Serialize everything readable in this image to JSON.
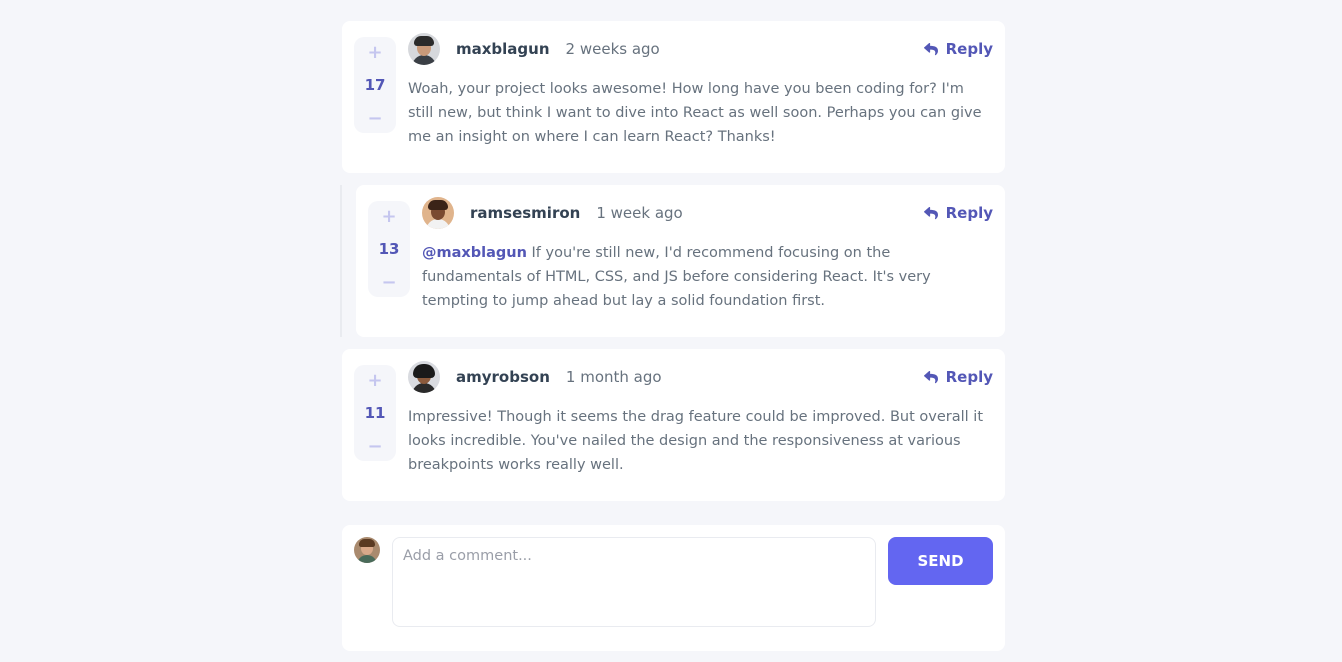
{
  "comments": [
    {
      "score": "17",
      "username": "maxblagun",
      "time": "2 weeks ago",
      "reply_label": "Reply",
      "content": "Woah, your project looks awesome! How long have you been coding for? I'm still new, but think I want to dive into React as well soon. Perhaps you can give me an insight on where I can learn React? Thanks!",
      "avatar_icon": "avatar-maxblagun-icon",
      "vote_up": "+",
      "vote_down": "−"
    },
    {
      "score": "13",
      "username": "ramsesmiron",
      "time": "1 week ago",
      "reply_label": "Reply",
      "mention": "@maxblagun",
      "content": " If you're still new, I'd recommend focusing on the fundamentals of HTML, CSS, and JS before considering React. It's very tempting to jump ahead but lay a solid foundation first.",
      "avatar_icon": "avatar-ramsesmiron-icon",
      "vote_up": "+",
      "vote_down": "−"
    },
    {
      "score": "11",
      "username": "amyrobson",
      "time": "1 month ago",
      "reply_label": "Reply",
      "content": "Impressive! Though it seems the drag feature could be improved. But overall it looks incredible. You've nailed the design and the responsiveness at various breakpoints works really well.",
      "avatar_icon": "avatar-amyrobson-icon",
      "vote_up": "+",
      "vote_down": "−"
    }
  ],
  "compose": {
    "placeholder": "Add a comment...",
    "value": "",
    "send_label": "SEND",
    "avatar_icon": "avatar-current-user-icon"
  },
  "colors": {
    "accent": "#5357b6",
    "send_button": "#6366f1",
    "background": "#f5f6fa",
    "text": "#67727e",
    "heading": "#334253"
  }
}
